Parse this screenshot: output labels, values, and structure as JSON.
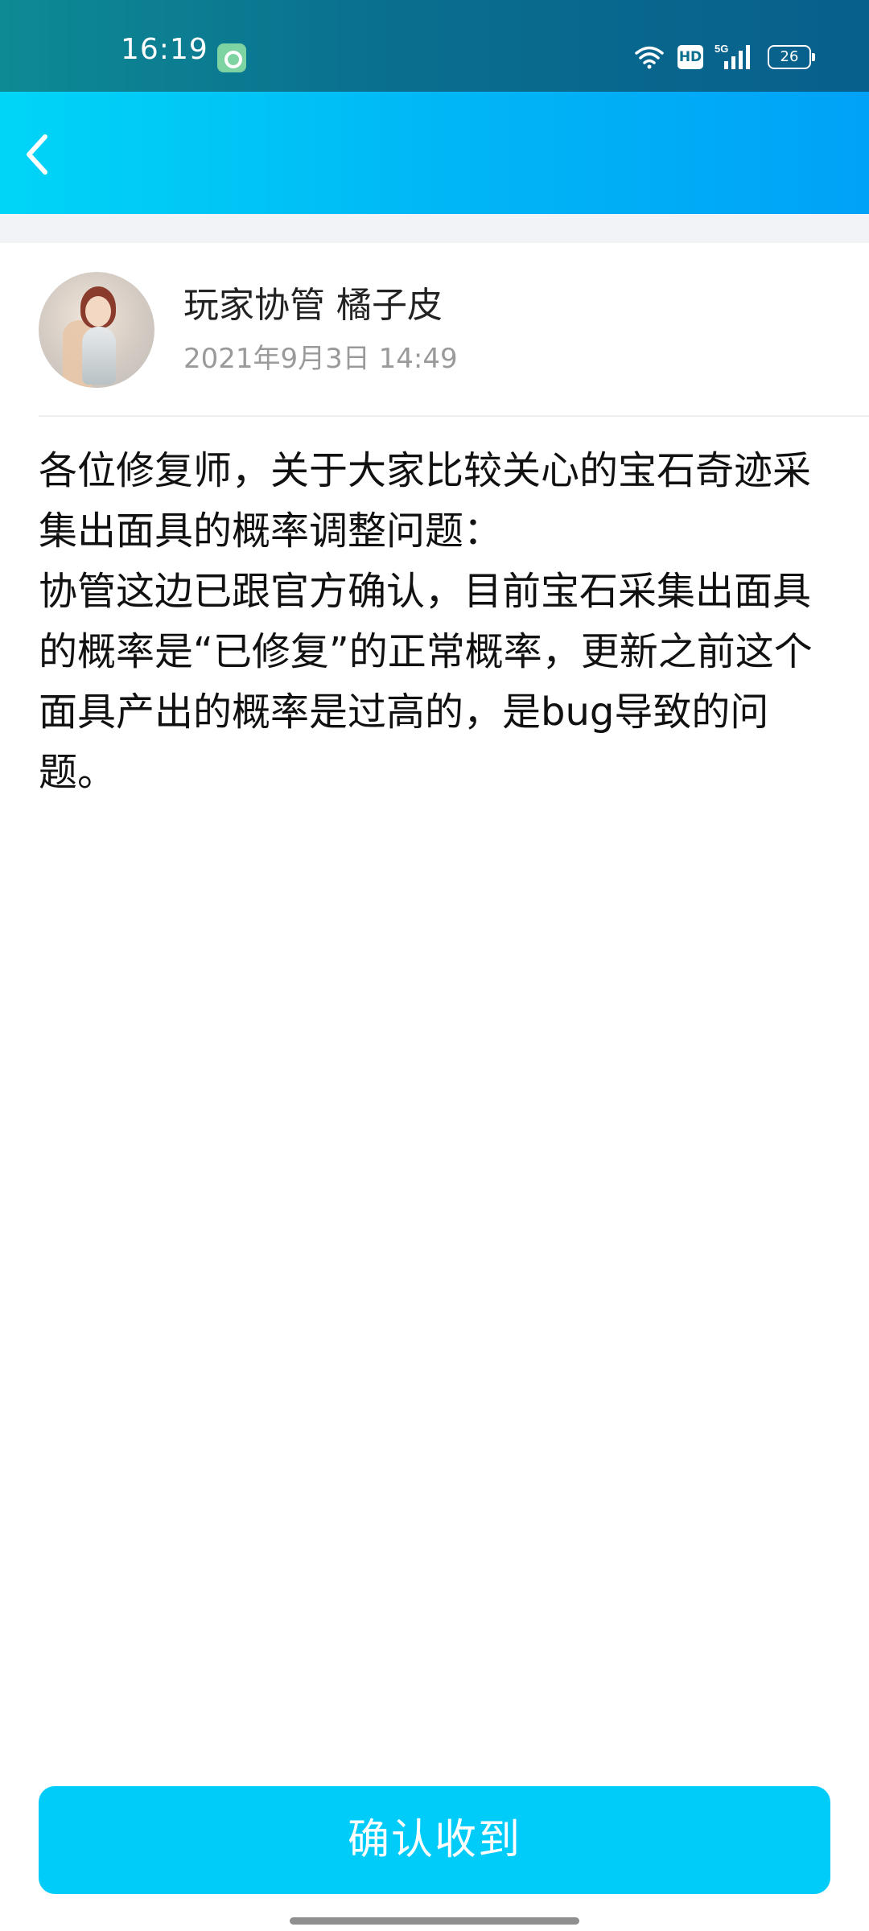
{
  "status_bar": {
    "time": "16:19",
    "network": "5G",
    "hd_label": "HD",
    "battery": "26",
    "icons": [
      "app-notification-icon",
      "wifi-icon",
      "hd-icon",
      "signal-icon",
      "battery-icon"
    ]
  },
  "header": {
    "back_icon": "chevron-left-icon",
    "colors": {
      "gradient_start": "#00d5f7",
      "gradient_end": "#00a2f7"
    }
  },
  "author": {
    "name": "玩家协管 橘子皮",
    "date": "2021年9月3日 14:49"
  },
  "message": {
    "paragraphs": [
      "各位修复师，关于大家比较关心的宝石奇迹采集出面具的概率调整问题：",
      "协管这边已跟官方确认，目前宝石采集出面具的概率是“已修复”的正常概率，更新之前这个面具产出的概率是过高的，是bug导致的问题。"
    ]
  },
  "actions": {
    "confirm_label": "确认收到",
    "confirm_color": "#00ccf9"
  }
}
